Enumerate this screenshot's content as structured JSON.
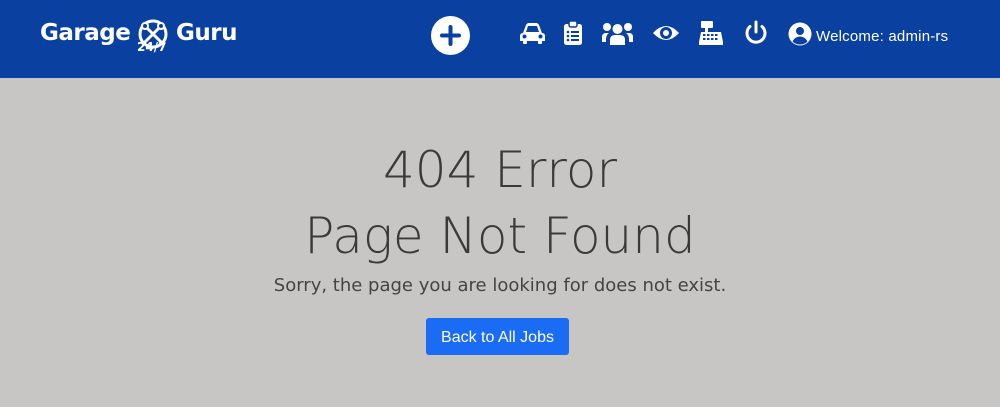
{
  "header": {
    "logo": {
      "word1": "Garage",
      "word2": "Guru",
      "sub": "24/7"
    },
    "icons": [
      "plus-icon",
      "car-icon",
      "clipboard-icon",
      "users-icon",
      "eye-icon",
      "cash-register-icon",
      "power-icon",
      "user-circle-icon"
    ],
    "welcome_text": "Welcome: admin-rs"
  },
  "main": {
    "title": "404 Error",
    "subtitle": "Page Not Found",
    "message": "Sorry, the page you are looking for does not exist.",
    "back_label": "Back to All Jobs"
  },
  "colors": {
    "navbar": "#0a41a0",
    "background": "#c8c5c5",
    "button": "#1a6cf5"
  }
}
